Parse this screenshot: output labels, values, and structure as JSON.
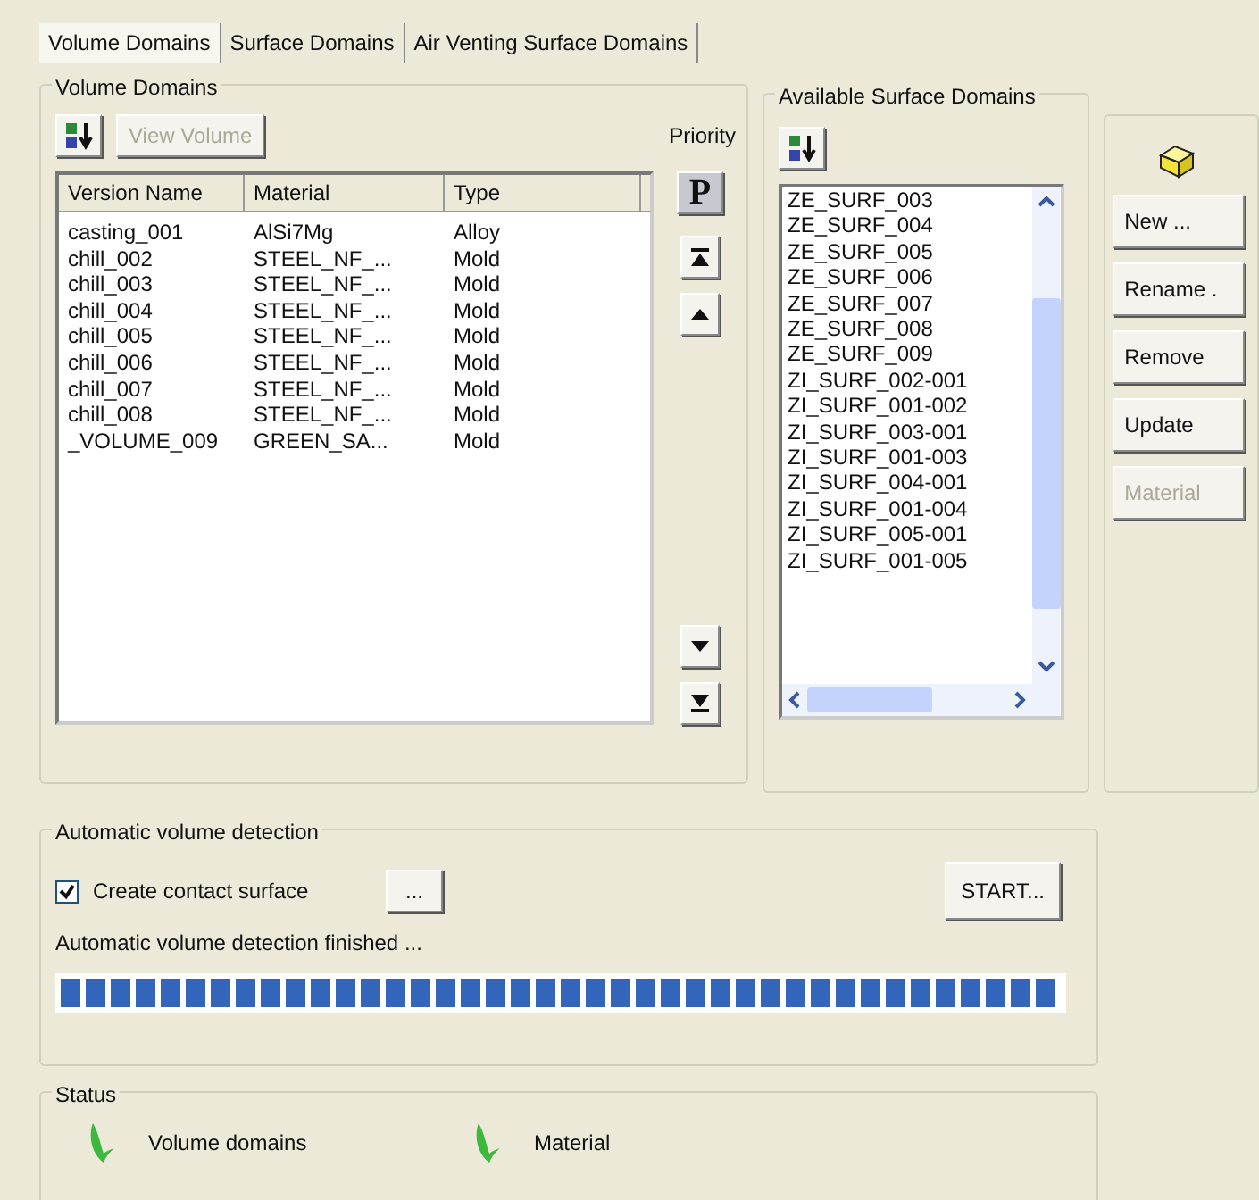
{
  "tabs": [
    {
      "label": "Volume Domains",
      "selected": true
    },
    {
      "label": "Surface Domains",
      "selected": false
    },
    {
      "label": "Air Venting Surface Domains",
      "selected": false
    }
  ],
  "volume_domains": {
    "title": "Volume Domains",
    "view_button": {
      "label": "View Volume",
      "disabled": true
    },
    "priority_label": "Priority",
    "priority_button": "P",
    "columns": [
      "Version Name",
      "Material",
      "Type"
    ],
    "rows": [
      [
        "casting_001",
        "AlSi7Mg",
        "Alloy"
      ],
      [
        "chill_002",
        "STEEL_NF_...",
        "Mold"
      ],
      [
        "chill_003",
        "STEEL_NF_...",
        "Mold"
      ],
      [
        "chill_004",
        "STEEL_NF_...",
        "Mold"
      ],
      [
        "chill_005",
        "STEEL_NF_...",
        "Mold"
      ],
      [
        "chill_006",
        "STEEL_NF_...",
        "Mold"
      ],
      [
        "chill_007",
        "STEEL_NF_...",
        "Mold"
      ],
      [
        "chill_008",
        "STEEL_NF_...",
        "Mold"
      ],
      [
        "_VOLUME_009",
        "GREEN_SA...",
        "Mold"
      ]
    ]
  },
  "surface_domains": {
    "title": "Available Surface Domains",
    "items": [
      "ZE_SURF_003",
      "ZE_SURF_004",
      "ZE_SURF_005",
      "ZE_SURF_006",
      "ZE_SURF_007",
      "ZE_SURF_008",
      "ZE_SURF_009",
      "ZI_SURF_002-001",
      "ZI_SURF_001-002",
      "ZI_SURF_003-001",
      "ZI_SURF_001-003",
      "ZI_SURF_004-001",
      "ZI_SURF_001-004",
      "ZI_SURF_005-001",
      "ZI_SURF_001-005"
    ]
  },
  "actions": [
    {
      "label": "New ...",
      "disabled": false
    },
    {
      "label": "Rename .",
      "disabled": false
    },
    {
      "label": "Remove",
      "disabled": false
    },
    {
      "label": "Update",
      "disabled": false
    },
    {
      "label": "Material",
      "disabled": true
    }
  ],
  "auto_detection": {
    "title": "Automatic volume detection",
    "create_contact": {
      "label": "Create contact surface",
      "checked": true
    },
    "more_button": "...",
    "start_button": "START...",
    "message": "Automatic volume detection finished ...",
    "progress": {
      "level": 1
    }
  },
  "status": {
    "title": "Status",
    "items": [
      {
        "label": "Volume domains"
      },
      {
        "label": "Material"
      }
    ]
  }
}
